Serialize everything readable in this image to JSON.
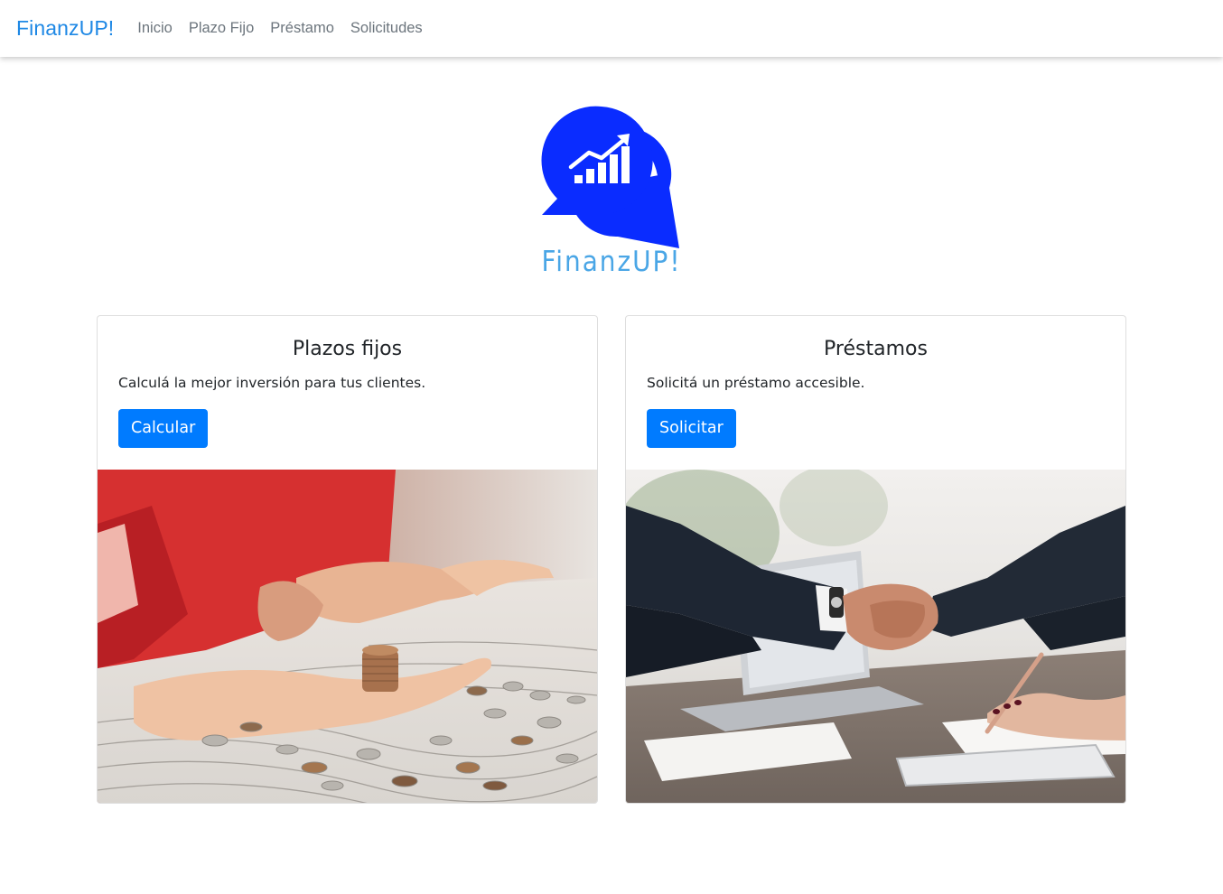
{
  "navbar": {
    "brand": "FinanzUP!",
    "links": [
      "Inicio",
      "Plazo Fijo",
      "Préstamo",
      "Solicitudes"
    ]
  },
  "logo": {
    "text": "FinanzUP!",
    "icon": "chat-bubbles-growth-chart-icon",
    "bubble_color": "#0a2cff",
    "text_color": "#4aa6e6"
  },
  "cards": [
    {
      "title": "Plazos fijos",
      "text": "Calculá la mejor inversión para tus clientes.",
      "button": "Calcular",
      "image": "hands-counting-coins-photo"
    },
    {
      "title": "Préstamos",
      "text": "Solicitá un préstamo accesible.",
      "button": "Solicitar",
      "image": "business-handshake-photo"
    }
  ],
  "colors": {
    "brand": "#1e88e5",
    "primary_button": "#007bff",
    "nav_link": "#6c757d"
  }
}
